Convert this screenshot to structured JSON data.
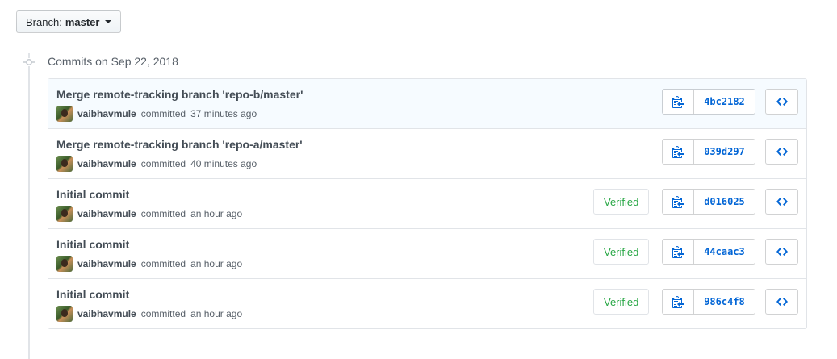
{
  "branch": {
    "prefix": "Branch:",
    "name": "master"
  },
  "group": {
    "title": "Commits on Sep 22, 2018"
  },
  "colors": {
    "link": "#0366d6",
    "verified": "#28a745",
    "highlight_row": "#f6fbff"
  },
  "icons": {
    "copy": "clippy-icon",
    "browse": "code-icon",
    "branch_caret": "caret-down-icon",
    "timeline_node": "git-commit-icon"
  },
  "commits": [
    {
      "title": "Merge remote-tracking branch 'repo-b/master'",
      "author": "vaibhavmule",
      "action": "committed",
      "time": "37 minutes ago",
      "verified": "",
      "sha": "4bc2182"
    },
    {
      "title": "Merge remote-tracking branch 'repo-a/master'",
      "author": "vaibhavmule",
      "action": "committed",
      "time": "40 minutes ago",
      "verified": "",
      "sha": "039d297"
    },
    {
      "title": "Initial commit",
      "author": "vaibhavmule",
      "action": "committed",
      "time": "an hour ago",
      "verified": "Verified",
      "sha": "d016025"
    },
    {
      "title": "Initial commit",
      "author": "vaibhavmule",
      "action": "committed",
      "time": "an hour ago",
      "verified": "Verified",
      "sha": "44caac3"
    },
    {
      "title": "Initial commit",
      "author": "vaibhavmule",
      "action": "committed",
      "time": "an hour ago",
      "verified": "Verified",
      "sha": "986c4f8"
    }
  ]
}
